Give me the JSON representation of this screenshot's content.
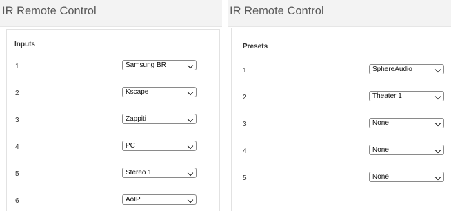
{
  "left_panel": {
    "title": "IR Remote Control",
    "section_label": "Inputs",
    "rows": [
      {
        "num": "1",
        "value": "Samsung BR"
      },
      {
        "num": "2",
        "value": "Kscape"
      },
      {
        "num": "3",
        "value": "Zappiti"
      },
      {
        "num": "4",
        "value": "PC"
      },
      {
        "num": "5",
        "value": "Stereo 1"
      },
      {
        "num": "6",
        "value": "AoIP"
      }
    ]
  },
  "right_panel": {
    "title": "IR Remote Control",
    "section_label": "Presets",
    "rows": [
      {
        "num": "1",
        "value": "SphereAudio"
      },
      {
        "num": "2",
        "value": "Theater 1"
      },
      {
        "num": "3",
        "value": "None"
      },
      {
        "num": "4",
        "value": "None"
      },
      {
        "num": "5",
        "value": "None"
      }
    ]
  },
  "icons": {
    "dropdown": "chevron-down-icon"
  }
}
